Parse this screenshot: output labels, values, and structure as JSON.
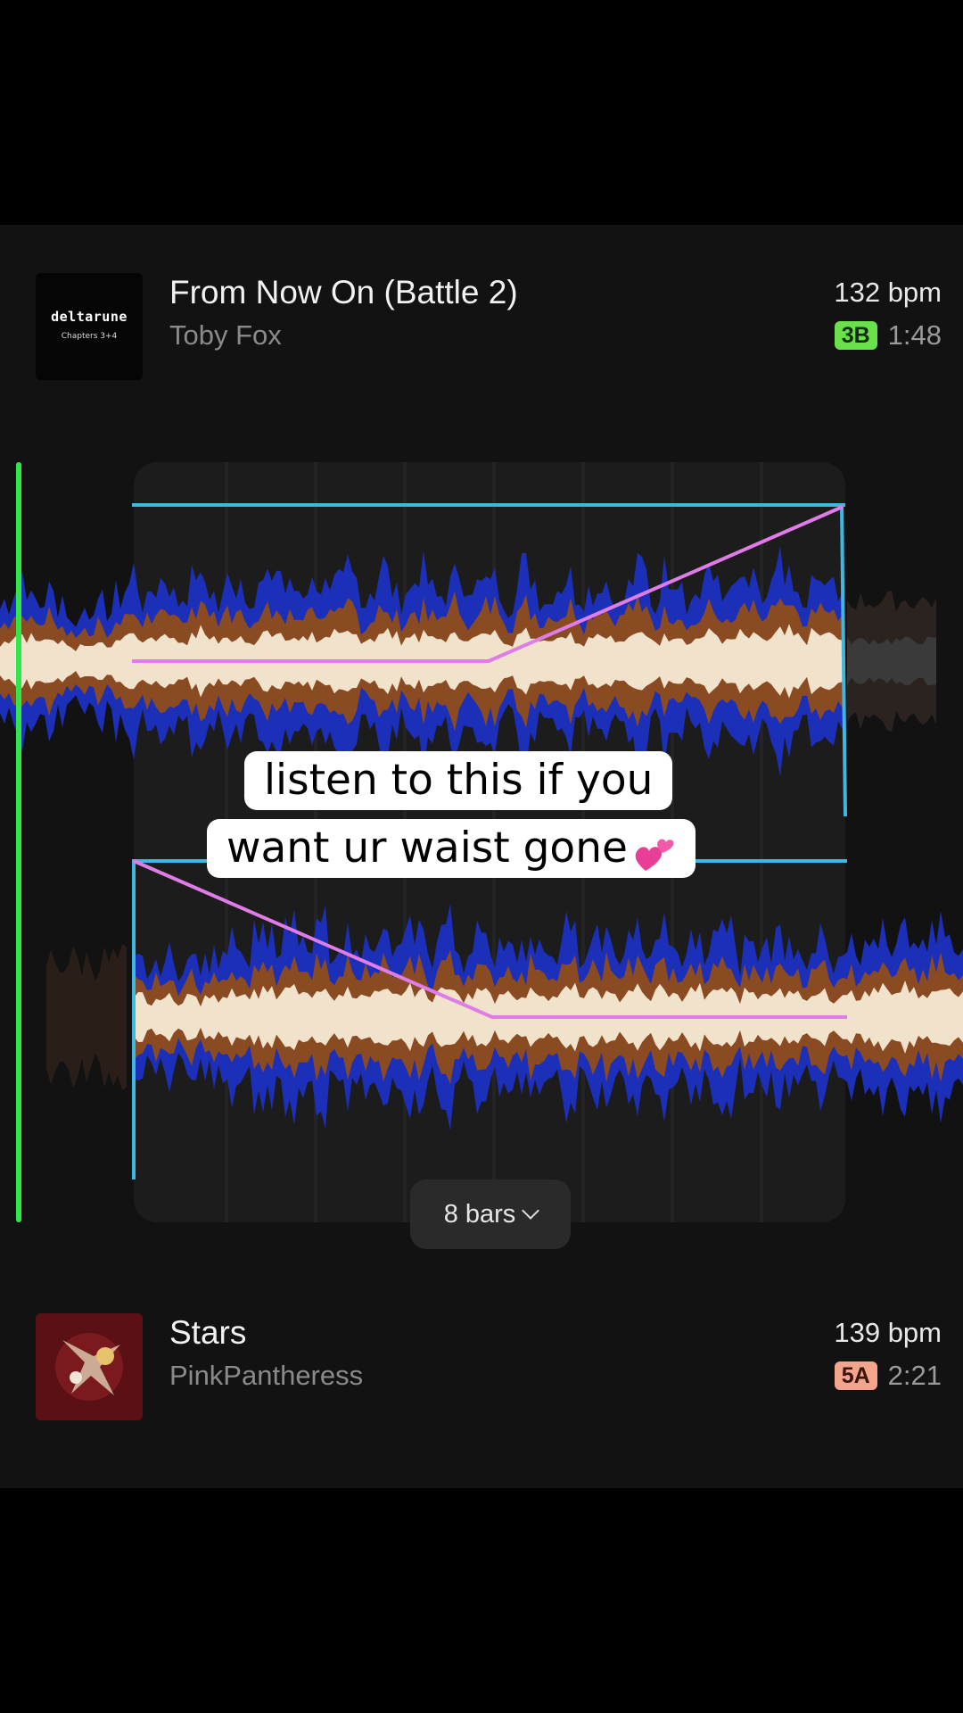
{
  "tracks": [
    {
      "title": "From Now On (Battle 2)",
      "artist": "Toby Fox",
      "bpm": "132 bpm",
      "key": "3B",
      "key_color": "#6ae04a",
      "duration": "1:48",
      "artwork": {
        "logo_text": "deltarune",
        "sub_text": "Chapters 3+4"
      }
    },
    {
      "title": "Stars",
      "artist": "PinkPantheress",
      "bpm": "139 bpm",
      "key": "5A",
      "key_color": "#f2a48c",
      "duration": "2:21"
    }
  ],
  "transition": {
    "length_label": "8 bars",
    "playhead_color": "#2ee84a",
    "volume_curve_color": "#e07ce8",
    "region_color": "#3fb7e0"
  },
  "waveform_colors": {
    "low": "#1c2fb8",
    "mid": "#8a4a22",
    "high": "#f1e2cc",
    "mid_light": "#c8782e"
  },
  "caption": {
    "line1": "listen to this if you",
    "line2": "want ur waist gone",
    "emoji": "two-hearts-emoji"
  }
}
